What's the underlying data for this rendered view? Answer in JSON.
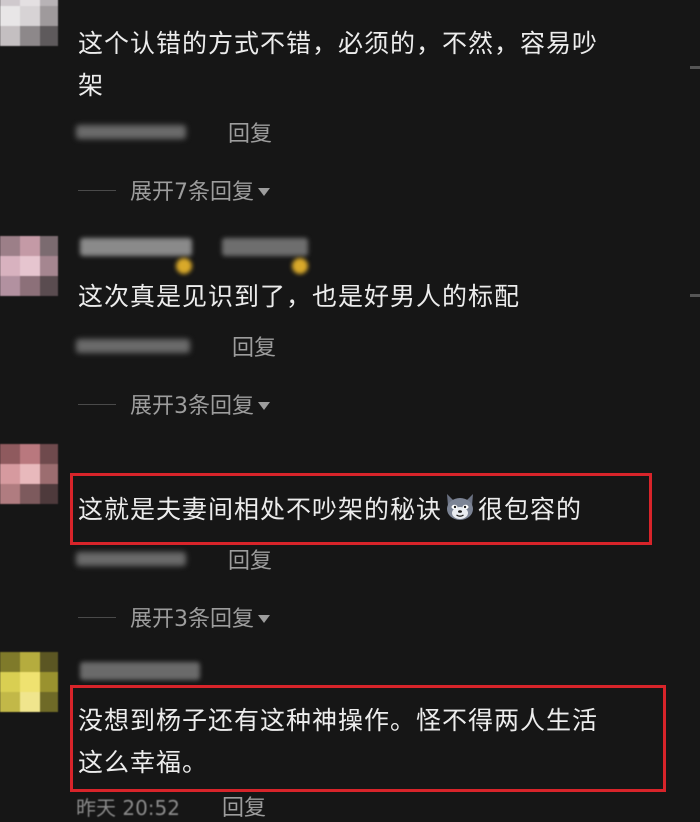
{
  "comments": [
    {
      "text_line1": "这个认错的方式不错，必须的，不然，容易吵",
      "text_line2": "架",
      "time": "",
      "reply_label": "回复",
      "expand_label": "展开7条回复"
    },
    {
      "text_line1": "这次真是见识到了，也是好男人的标配",
      "time": "",
      "reply_label": "回复",
      "expand_label": "展开3条回复"
    },
    {
      "text_before_emoji": "这就是夫妻间相处不吵架的秘诀",
      "emoji": "wolf-emoji",
      "text_after_emoji": "很包容的",
      "time": "",
      "reply_label": "回复",
      "expand_label": "展开3条回复"
    },
    {
      "text_line1": "没想到杨子还有这种神操作。怪不得两人生活",
      "text_line2": "这么幸福。",
      "time": "昨天 20:52",
      "reply_label": "回复"
    }
  ],
  "colors": {
    "background": "#161616",
    "text": "#ececec",
    "muted": "#9d9d9d",
    "highlight": "#d8242a"
  },
  "icons": [
    "caret-down-icon",
    "wolf-emoji"
  ]
}
